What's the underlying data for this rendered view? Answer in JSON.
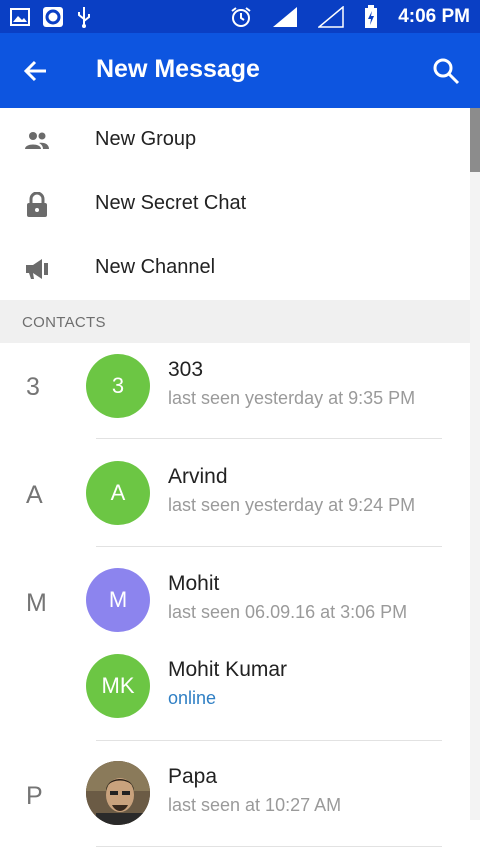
{
  "status_bar": {
    "time": "4:06 PM",
    "icons": [
      "gallery-icon",
      "opera-icon",
      "usb-icon",
      "alarm-icon",
      "signal-icon",
      "signal-empty-icon",
      "battery-charging-icon"
    ]
  },
  "header": {
    "title": "New Message",
    "back_icon": "arrow-left-icon",
    "search_icon": "search-icon"
  },
  "menu": [
    {
      "label": "New Group",
      "icon": "group-icon"
    },
    {
      "label": "New Secret Chat",
      "icon": "lock-icon"
    },
    {
      "label": "New Channel",
      "icon": "megaphone-icon"
    }
  ],
  "contacts_header": "CONTACTS",
  "groups": [
    {
      "letter": "3",
      "contacts": [
        {
          "initials": "3",
          "name": "303",
          "status": "last seen yesterday at 9:35 PM",
          "avatar_color": "#6cc644"
        }
      ]
    },
    {
      "letter": "A",
      "contacts": [
        {
          "initials": "A",
          "name": "Arvind",
          "status": "last seen yesterday at 9:24 PM",
          "avatar_color": "#6cc644"
        }
      ]
    },
    {
      "letter": "M",
      "contacts": [
        {
          "initials": "M",
          "name": "Mohit",
          "status": "last seen 06.09.16 at 3:06 PM",
          "avatar_color": "#8c84ee"
        },
        {
          "initials": "MK",
          "name": "Mohit Kumar",
          "status": "online",
          "avatar_color": "#6cc644"
        }
      ]
    },
    {
      "letter": "P",
      "contacts": [
        {
          "initials": "",
          "name": "Papa",
          "status": "last seen at 10:27 AM",
          "avatar_color": "#5a4a3a"
        }
      ]
    }
  ],
  "colors": {
    "statusbar": "#0a3fc4",
    "appbar": "#0d55e0",
    "online": "#2f7fc4",
    "green_avatar": "#6cc644",
    "purple_avatar": "#8c84ee"
  }
}
